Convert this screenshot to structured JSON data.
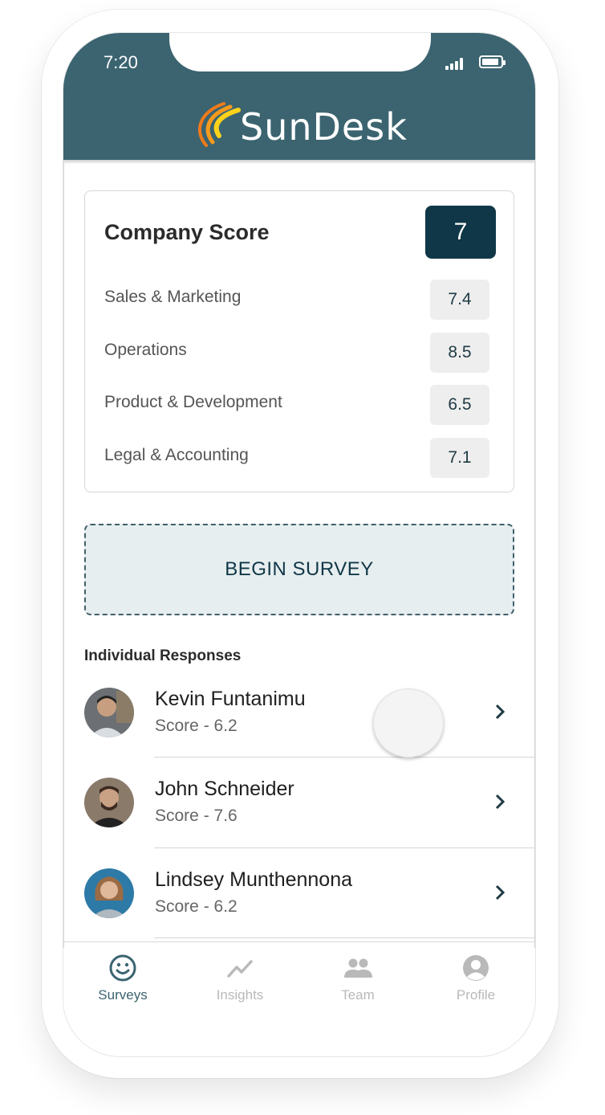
{
  "status_bar": {
    "time": "7:20"
  },
  "app": {
    "brand_name": "SunDesk",
    "brand_colors": {
      "header": "#3b6470",
      "accent": "#0f3747"
    }
  },
  "company_card": {
    "title": "Company Score",
    "score": "7",
    "departments": [
      {
        "name": "Sales & Marketing",
        "score": "7.4"
      },
      {
        "name": "Operations",
        "score": "8.5"
      },
      {
        "name": "Product & Development",
        "score": "6.5"
      },
      {
        "name": "Legal & Accounting",
        "score": "7.1"
      }
    ]
  },
  "survey_button": {
    "label": "BEGIN SURVEY"
  },
  "responses": {
    "title": "Individual Responses",
    "items": [
      {
        "name": "Kevin Funtanimu",
        "score": "Score - 6.2"
      },
      {
        "name": "John Schneider",
        "score": "Score - 7.6"
      },
      {
        "name": "Lindsey Munthennona",
        "score": "Score - 6.2"
      }
    ]
  },
  "tabs": [
    {
      "label": "Surveys",
      "icon": "smiley-icon",
      "active": true
    },
    {
      "label": "Insights",
      "icon": "trend-icon",
      "active": false
    },
    {
      "label": "Team",
      "icon": "people-icon",
      "active": false
    },
    {
      "label": "Profile",
      "icon": "account-icon",
      "active": false
    }
  ]
}
